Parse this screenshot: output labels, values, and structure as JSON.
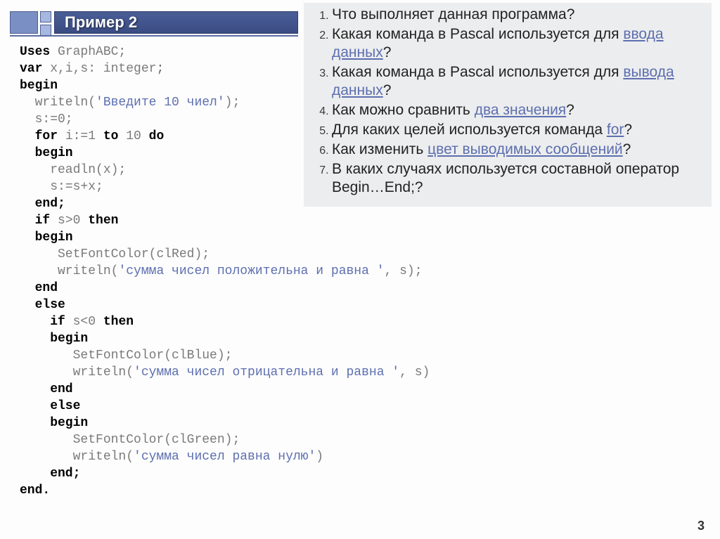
{
  "title": "Пример 2",
  "page_number": "3",
  "code": {
    "l1_kw": "Uses",
    "l1_id": " GraphABC;",
    "l2_kw": "var",
    "l2_ids": " x,i,s: ",
    "l2_ty": "integer",
    "l2_end": ";",
    "l3": "begin",
    "l4a": "  writeln(",
    "l4s": "'Введите 10 чиел'",
    "l4b": ");",
    "l5": "  s:=0;",
    "l6a": "  ",
    "l6kw1": "for",
    "l6b": " i:=1 ",
    "l6kw2": "to",
    "l6c": " 10 ",
    "l6kw3": "do",
    "l7": "  begin",
    "l8": "    readln(x);",
    "l9": "    s:=s+x;",
    "l10": "  end;",
    "l11a": "  ",
    "l11kw": "if",
    "l11b": " s>0 ",
    "l11kw2": "then",
    "l12": "  begin",
    "l13a": "     SetFontColor(",
    "l13c": "clRed",
    "l13b": ");",
    "l14a": "     writeln(",
    "l14s": "'сумма чисел положительна и равна '",
    "l14b": ", s);",
    "l15": "  end",
    "l16": "  else",
    "l17a": "    ",
    "l17kw": "if",
    "l17b": " s<0 ",
    "l17kw2": "then",
    "l18": "    begin",
    "l19a": "       SetFontColor(",
    "l19c": "clBlue",
    "l19b": ");",
    "l20a": "       writeln(",
    "l20s": "'сумма чисел отрицательна и равна '",
    "l20b": ", s)",
    "l21": "    end",
    "l22": "    else",
    "l23": "    begin",
    "l24a": "       SetFontColor(",
    "l24c": "clGreen",
    "l24b": ");",
    "l25a": "       writeln(",
    "l25s": "'сумма чисел равна нулю'",
    "l25b": ")",
    "l26": "    end;",
    "l27": "end."
  },
  "questions": [
    {
      "pre": "Что выполняет данная программа?"
    },
    {
      "pre": "Какая команда в Pascal используется для ",
      "link": "ввода данных",
      "post": "?"
    },
    {
      "pre": "Какая команда в Pascal используется для ",
      "link": "вывода данных",
      "post": "?"
    },
    {
      "pre": "Как можно сравнить ",
      "link": "два значения",
      "post": "?"
    },
    {
      "pre": "Для каких целей используется команда ",
      "link": "for",
      "post": "?"
    },
    {
      "pre": "Как изменить ",
      "link": "цвет выводимых сообщений",
      "post": "?"
    },
    {
      "pre": "В каких случаях используется составной оператор Begin…End;?"
    }
  ]
}
